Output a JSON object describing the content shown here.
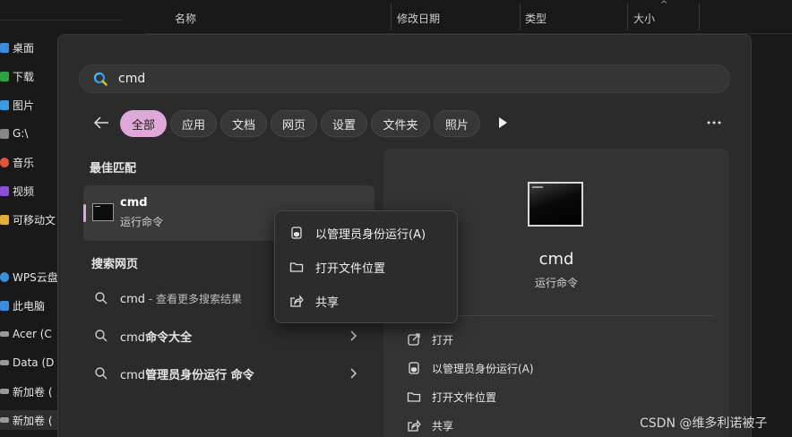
{
  "explorer": {
    "columns": [
      "名称",
      "修改日期",
      "类型",
      "大小"
    ],
    "nav_items": [
      {
        "label": "桌面",
        "color": "#3b8ddd"
      },
      {
        "label": "下载",
        "color": "#2ea043"
      },
      {
        "label": "图片",
        "color": "#3b9ae0"
      },
      {
        "label": "G:\\",
        "color": "#888888"
      },
      {
        "label": "音乐",
        "color": "#e0543a"
      },
      {
        "label": "视频",
        "color": "#8a4fd6"
      },
      {
        "label": "可移动文",
        "color": "#e0b13a"
      },
      {
        "label": "WPS云盘",
        "color": "#3b8ddd"
      },
      {
        "label": "此电脑",
        "color": "#3b8ddd"
      },
      {
        "label": "Acer (C",
        "color": "#9a9a9a"
      },
      {
        "label": "Data (D",
        "color": "#9a9a9a"
      },
      {
        "label": "新加卷 (",
        "color": "#9a9a9a"
      },
      {
        "label": "新加卷 (",
        "color": "#9a9a9a"
      }
    ]
  },
  "search": {
    "query": "cmd",
    "filters": [
      "全部",
      "应用",
      "文档",
      "网页",
      "设置",
      "文件夹",
      "照片"
    ],
    "active_filter": "全部",
    "accent_color": "#e0a8d8"
  },
  "results": {
    "best_match_heading": "最佳匹配",
    "best_match": {
      "title": "cmd",
      "subtitle": "运行命令"
    },
    "web_heading": "搜索网页",
    "web_items": [
      {
        "prefix": "cmd",
        "suffix": " - 查看更多搜索结果"
      },
      {
        "prefix": "cmd",
        "suffix": "命令大全"
      },
      {
        "prefix": "cmd",
        "suffix": "管理员身份运行 命令"
      }
    ]
  },
  "detail": {
    "title": "cmd",
    "subtitle": "运行命令",
    "actions": [
      "打开",
      "以管理员身份运行(A)",
      "打开文件位置",
      "共享"
    ]
  },
  "context_menu": {
    "items": [
      "以管理员身份运行(A)",
      "打开文件位置",
      "共享"
    ]
  },
  "watermark": "CSDN @维多利诺被子"
}
